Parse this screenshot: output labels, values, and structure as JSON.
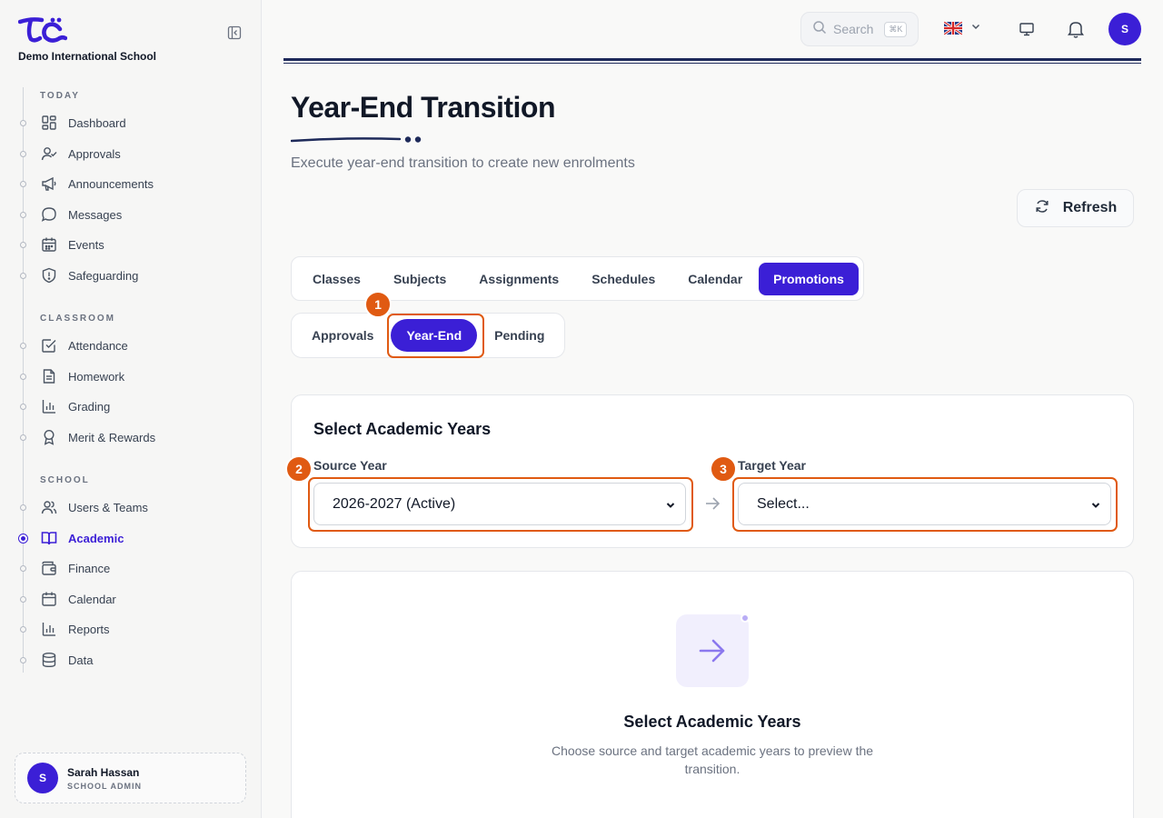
{
  "school": {
    "name": "Demo International School"
  },
  "sidebar": {
    "sections": [
      {
        "title": "TODAY"
      },
      {
        "title": "CLASSROOM"
      },
      {
        "title": "SCHOOL"
      }
    ],
    "items": [
      {
        "label": "Dashboard",
        "icon": "dashboard-icon"
      },
      {
        "label": "Approvals",
        "icon": "user-check-icon"
      },
      {
        "label": "Announcements",
        "icon": "megaphone-icon"
      },
      {
        "label": "Messages",
        "icon": "chat-bubble-icon"
      },
      {
        "label": "Events",
        "icon": "calendar-icon"
      },
      {
        "label": "Safeguarding",
        "icon": "shield-alert-icon"
      },
      {
        "label": "Attendance",
        "icon": "checkbox-icon"
      },
      {
        "label": "Homework",
        "icon": "document-icon"
      },
      {
        "label": "Grading",
        "icon": "bar-chart-icon"
      },
      {
        "label": "Merit & Rewards",
        "icon": "award-icon"
      },
      {
        "label": "Users & Teams",
        "icon": "users-icon"
      },
      {
        "label": "Academic",
        "icon": "book-open-icon",
        "active": true
      },
      {
        "label": "Finance",
        "icon": "wallet-icon"
      },
      {
        "label": "Calendar",
        "icon": "calendar-icon"
      },
      {
        "label": "Reports",
        "icon": "bar-chart-icon"
      },
      {
        "label": "Data",
        "icon": "database-icon"
      }
    ],
    "user": {
      "initial": "S",
      "name": "Sarah Hassan",
      "role": "SCHOOL ADMIN"
    }
  },
  "topbar": {
    "search_placeholder": "Search",
    "search_shortcut": "⌘K",
    "avatar_initial": "S"
  },
  "page": {
    "title": "Year-End Transition",
    "subtitle": "Execute year-end transition to create new enrolments",
    "refresh_label": "Refresh"
  },
  "tabs": [
    "Classes",
    "Subjects",
    "Assignments",
    "Schedules",
    "Calendar",
    "Promotions"
  ],
  "active_tab": "Promotions",
  "subtabs": [
    "Approvals",
    "Year-End",
    "Pending"
  ],
  "active_subtab": "Year-End",
  "markers": [
    "1",
    "2",
    "3"
  ],
  "select_card": {
    "title": "Select Academic Years",
    "source_label": "Source Year",
    "source_value": "2026-2027 (Active)",
    "target_label": "Target Year",
    "target_value": "Select..."
  },
  "empty_state": {
    "title": "Select Academic Years",
    "description": "Choose source and target academic years to preview the transition."
  },
  "colors": {
    "accent": "#3b1fd6",
    "highlight": "#e05a12",
    "navy": "#1e2a5a"
  }
}
